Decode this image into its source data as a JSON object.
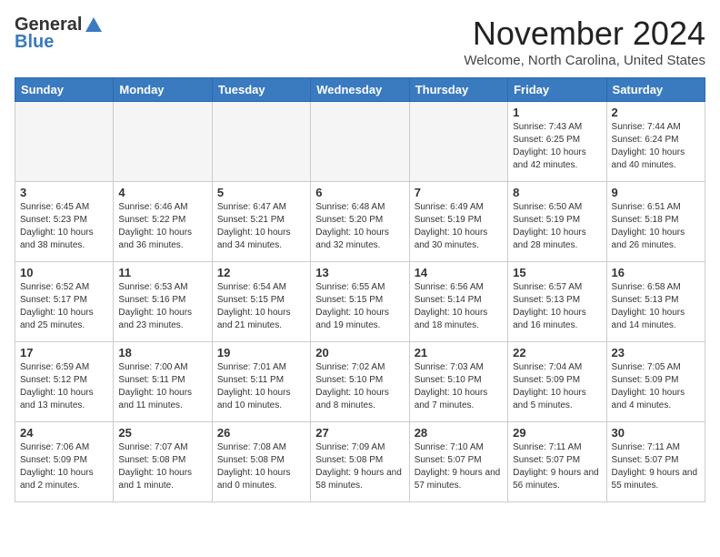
{
  "header": {
    "logo_line1": "General",
    "logo_line2": "Blue",
    "month_title": "November 2024",
    "location": "Welcome, North Carolina, United States"
  },
  "weekdays": [
    "Sunday",
    "Monday",
    "Tuesday",
    "Wednesday",
    "Thursday",
    "Friday",
    "Saturday"
  ],
  "weeks": [
    [
      {
        "day": "",
        "info": ""
      },
      {
        "day": "",
        "info": ""
      },
      {
        "day": "",
        "info": ""
      },
      {
        "day": "",
        "info": ""
      },
      {
        "day": "",
        "info": ""
      },
      {
        "day": "1",
        "info": "Sunrise: 7:43 AM\nSunset: 6:25 PM\nDaylight: 10 hours and 42 minutes."
      },
      {
        "day": "2",
        "info": "Sunrise: 7:44 AM\nSunset: 6:24 PM\nDaylight: 10 hours and 40 minutes."
      }
    ],
    [
      {
        "day": "3",
        "info": "Sunrise: 6:45 AM\nSunset: 5:23 PM\nDaylight: 10 hours and 38 minutes."
      },
      {
        "day": "4",
        "info": "Sunrise: 6:46 AM\nSunset: 5:22 PM\nDaylight: 10 hours and 36 minutes."
      },
      {
        "day": "5",
        "info": "Sunrise: 6:47 AM\nSunset: 5:21 PM\nDaylight: 10 hours and 34 minutes."
      },
      {
        "day": "6",
        "info": "Sunrise: 6:48 AM\nSunset: 5:20 PM\nDaylight: 10 hours and 32 minutes."
      },
      {
        "day": "7",
        "info": "Sunrise: 6:49 AM\nSunset: 5:19 PM\nDaylight: 10 hours and 30 minutes."
      },
      {
        "day": "8",
        "info": "Sunrise: 6:50 AM\nSunset: 5:19 PM\nDaylight: 10 hours and 28 minutes."
      },
      {
        "day": "9",
        "info": "Sunrise: 6:51 AM\nSunset: 5:18 PM\nDaylight: 10 hours and 26 minutes."
      }
    ],
    [
      {
        "day": "10",
        "info": "Sunrise: 6:52 AM\nSunset: 5:17 PM\nDaylight: 10 hours and 25 minutes."
      },
      {
        "day": "11",
        "info": "Sunrise: 6:53 AM\nSunset: 5:16 PM\nDaylight: 10 hours and 23 minutes."
      },
      {
        "day": "12",
        "info": "Sunrise: 6:54 AM\nSunset: 5:15 PM\nDaylight: 10 hours and 21 minutes."
      },
      {
        "day": "13",
        "info": "Sunrise: 6:55 AM\nSunset: 5:15 PM\nDaylight: 10 hours and 19 minutes."
      },
      {
        "day": "14",
        "info": "Sunrise: 6:56 AM\nSunset: 5:14 PM\nDaylight: 10 hours and 18 minutes."
      },
      {
        "day": "15",
        "info": "Sunrise: 6:57 AM\nSunset: 5:13 PM\nDaylight: 10 hours and 16 minutes."
      },
      {
        "day": "16",
        "info": "Sunrise: 6:58 AM\nSunset: 5:13 PM\nDaylight: 10 hours and 14 minutes."
      }
    ],
    [
      {
        "day": "17",
        "info": "Sunrise: 6:59 AM\nSunset: 5:12 PM\nDaylight: 10 hours and 13 minutes."
      },
      {
        "day": "18",
        "info": "Sunrise: 7:00 AM\nSunset: 5:11 PM\nDaylight: 10 hours and 11 minutes."
      },
      {
        "day": "19",
        "info": "Sunrise: 7:01 AM\nSunset: 5:11 PM\nDaylight: 10 hours and 10 minutes."
      },
      {
        "day": "20",
        "info": "Sunrise: 7:02 AM\nSunset: 5:10 PM\nDaylight: 10 hours and 8 minutes."
      },
      {
        "day": "21",
        "info": "Sunrise: 7:03 AM\nSunset: 5:10 PM\nDaylight: 10 hours and 7 minutes."
      },
      {
        "day": "22",
        "info": "Sunrise: 7:04 AM\nSunset: 5:09 PM\nDaylight: 10 hours and 5 minutes."
      },
      {
        "day": "23",
        "info": "Sunrise: 7:05 AM\nSunset: 5:09 PM\nDaylight: 10 hours and 4 minutes."
      }
    ],
    [
      {
        "day": "24",
        "info": "Sunrise: 7:06 AM\nSunset: 5:09 PM\nDaylight: 10 hours and 2 minutes."
      },
      {
        "day": "25",
        "info": "Sunrise: 7:07 AM\nSunset: 5:08 PM\nDaylight: 10 hours and 1 minute."
      },
      {
        "day": "26",
        "info": "Sunrise: 7:08 AM\nSunset: 5:08 PM\nDaylight: 10 hours and 0 minutes."
      },
      {
        "day": "27",
        "info": "Sunrise: 7:09 AM\nSunset: 5:08 PM\nDaylight: 9 hours and 58 minutes."
      },
      {
        "day": "28",
        "info": "Sunrise: 7:10 AM\nSunset: 5:07 PM\nDaylight: 9 hours and 57 minutes."
      },
      {
        "day": "29",
        "info": "Sunrise: 7:11 AM\nSunset: 5:07 PM\nDaylight: 9 hours and 56 minutes."
      },
      {
        "day": "30",
        "info": "Sunrise: 7:11 AM\nSunset: 5:07 PM\nDaylight: 9 hours and 55 minutes."
      }
    ]
  ]
}
